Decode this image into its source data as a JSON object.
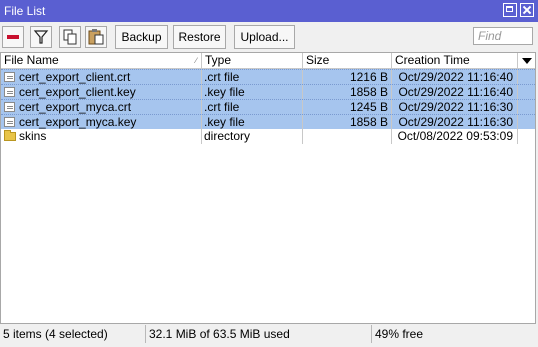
{
  "window": {
    "title": "File List"
  },
  "toolbar": {
    "remove_icon": "remove-icon",
    "filter_icon": "filter-icon",
    "copy_icon": "copy-icon",
    "paste_icon": "paste-icon",
    "backup_label": "Backup",
    "restore_label": "Restore",
    "upload_label": "Upload...",
    "find_placeholder": "Find"
  },
  "columns": {
    "name": "File Name",
    "type": "Type",
    "size": "Size",
    "time": "Creation Time"
  },
  "rows": [
    {
      "name": "cert_export_client.crt",
      "type": ".crt file",
      "size": "1216 B",
      "time": "Oct/29/2022 11:16:40",
      "selected": true,
      "icon": "file-icon"
    },
    {
      "name": "cert_export_client.key",
      "type": ".key file",
      "size": "1858 B",
      "time": "Oct/29/2022 11:16:40",
      "selected": true,
      "icon": "file-icon"
    },
    {
      "name": "cert_export_myca.crt",
      "type": ".crt file",
      "size": "1245 B",
      "time": "Oct/29/2022 11:16:30",
      "selected": true,
      "icon": "file-icon"
    },
    {
      "name": "cert_export_myca.key",
      "type": ".key file",
      "size": "1858 B",
      "time": "Oct/29/2022 11:16:30",
      "selected": true,
      "icon": "file-icon"
    },
    {
      "name": "skins",
      "type": "directory",
      "size": "",
      "time": "Oct/08/2022 09:53:09",
      "selected": false,
      "icon": "folder-icon"
    }
  ],
  "status": {
    "count": "5 items (4 selected)",
    "usage": "32.1 MiB of 63.5 MiB used",
    "free": "49% free"
  },
  "colors": {
    "titlebar": "#5a5fd1",
    "selection": "#a6c5ee",
    "remove_icon": "#c8102e"
  }
}
